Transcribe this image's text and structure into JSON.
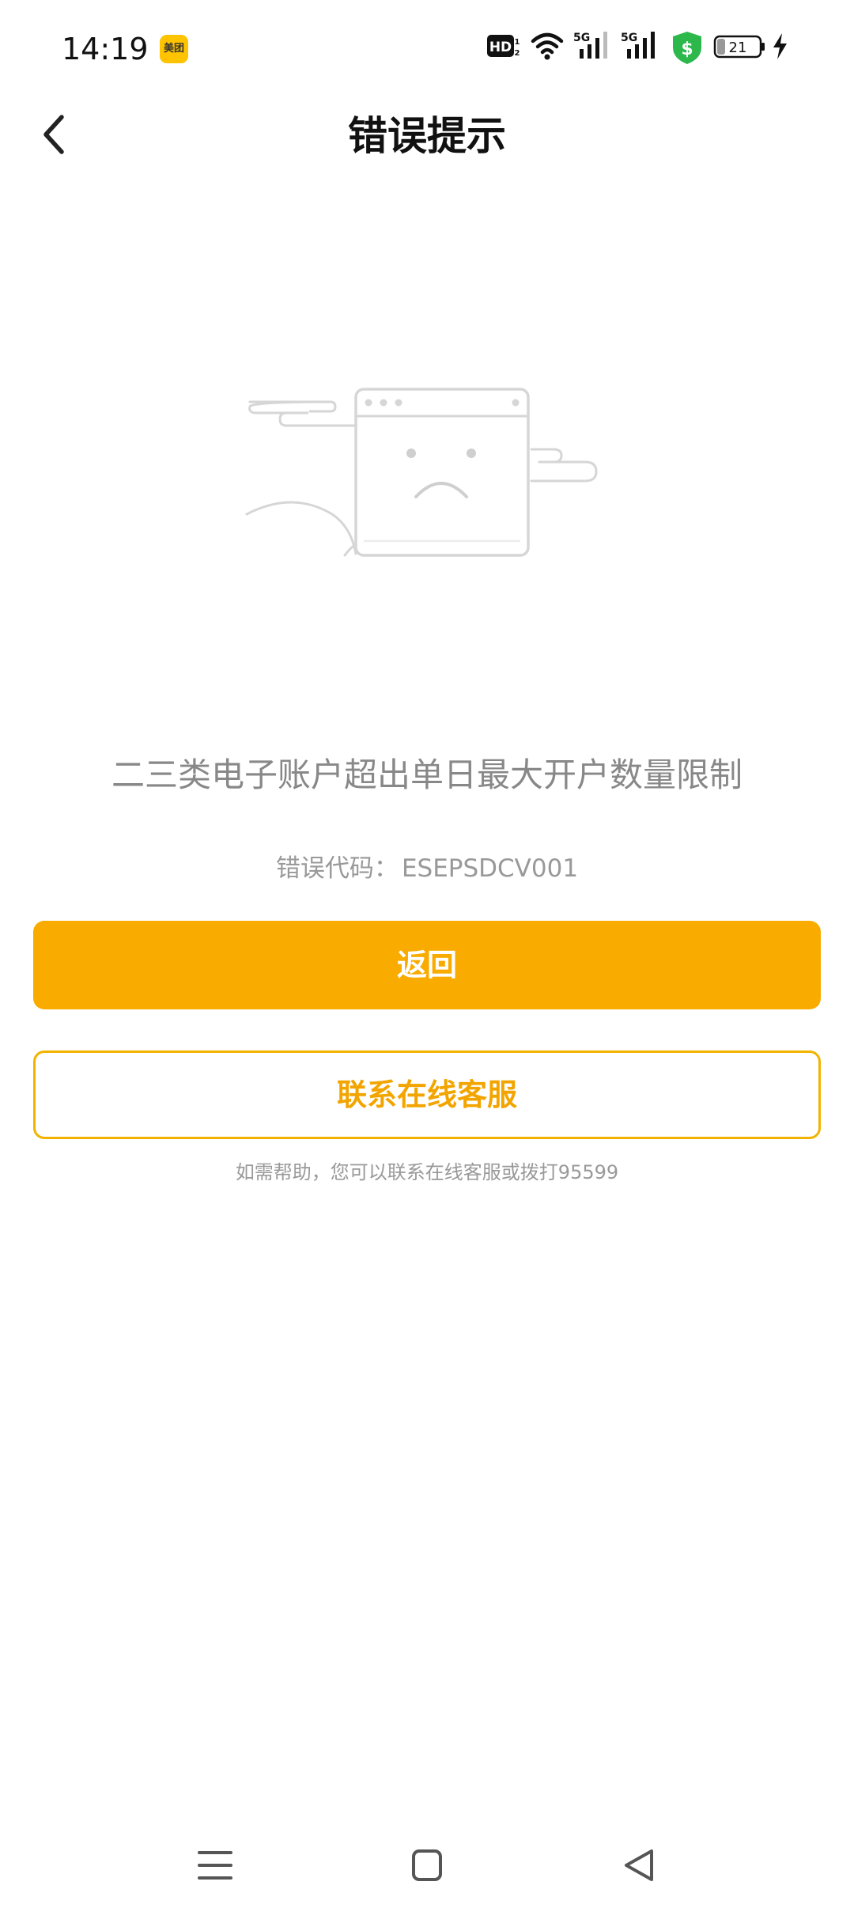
{
  "status_bar": {
    "time": "14:19",
    "app_badge": "美团",
    "hd_label": "HD",
    "network_1": "5G",
    "network_2": "5G",
    "battery": "21",
    "colors": {
      "shield": "#2DB84C"
    }
  },
  "header": {
    "title": "错误提示",
    "back_icon": "chevron-left-icon"
  },
  "illustration": {
    "icon": "sad-browser-window-illustration"
  },
  "message": {
    "text": "二三类电子账户超出单日最大开户数量限制",
    "code_label": "错误代码：",
    "code_value": "ESEPSDCV001"
  },
  "actions": {
    "return_label": "返回",
    "service_label": "联系在线客服",
    "help_text": "如需帮助，您可以联系在线客服或拨打95599",
    "colors": {
      "primary": "#F9AB00",
      "outline": "#F2B300"
    }
  },
  "nav": {
    "menu_icon": "menu-icon",
    "home_icon": "home-square-icon",
    "back_icon": "triangle-back-icon"
  }
}
